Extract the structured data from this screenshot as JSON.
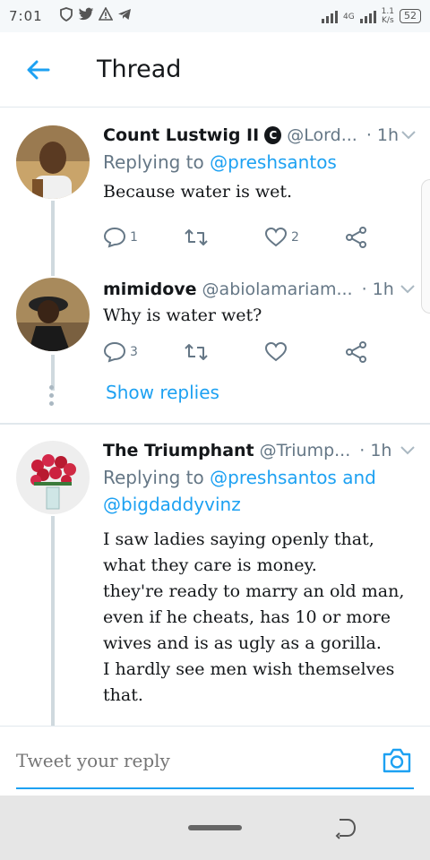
{
  "status_bar": {
    "time": "7:01",
    "network": "4G",
    "speed_value": "1.1",
    "speed_unit": "K/s",
    "battery": "52"
  },
  "header": {
    "title": "Thread"
  },
  "tweets": [
    {
      "name": "Count Lustwig II",
      "verified_letter": "C",
      "handle": "@Lord...",
      "dot": "·",
      "time": "1h",
      "replying_prefix": "Replying to",
      "replying_mentions": "@preshsantos",
      "text": "Because water is wet.",
      "reply_count": "1",
      "retweet_count": "",
      "like_count": "2"
    },
    {
      "name": "mimidove",
      "handle": "@abiolamariam...",
      "dot": "·",
      "time": "1h",
      "text": "Why is water wet?",
      "reply_count": "3",
      "retweet_count": "",
      "like_count": ""
    },
    {
      "name": "The Triumphant",
      "handle": "@Triump...",
      "dot": "·",
      "time": "1h",
      "replying_prefix": "Replying to",
      "replying_mentions": "@preshsantos and",
      "replying_mentions_2": "@bigdaddyvinz",
      "text_lines": [
        "I saw ladies saying openly that,",
        "what they care is money.",
        "they're ready to marry an old man,",
        "even if he cheats, has 10 or more",
        "wives and is as ugly as a gorilla.",
        "I hardly see men wish  themselves",
        "that."
      ]
    }
  ],
  "show_replies_label": "Show replies",
  "reply_bar": {
    "placeholder": "Tweet your reply"
  },
  "colors": {
    "accent": "#1da1f2",
    "secondary_text": "#657786",
    "divider": "#e1e8ed"
  }
}
